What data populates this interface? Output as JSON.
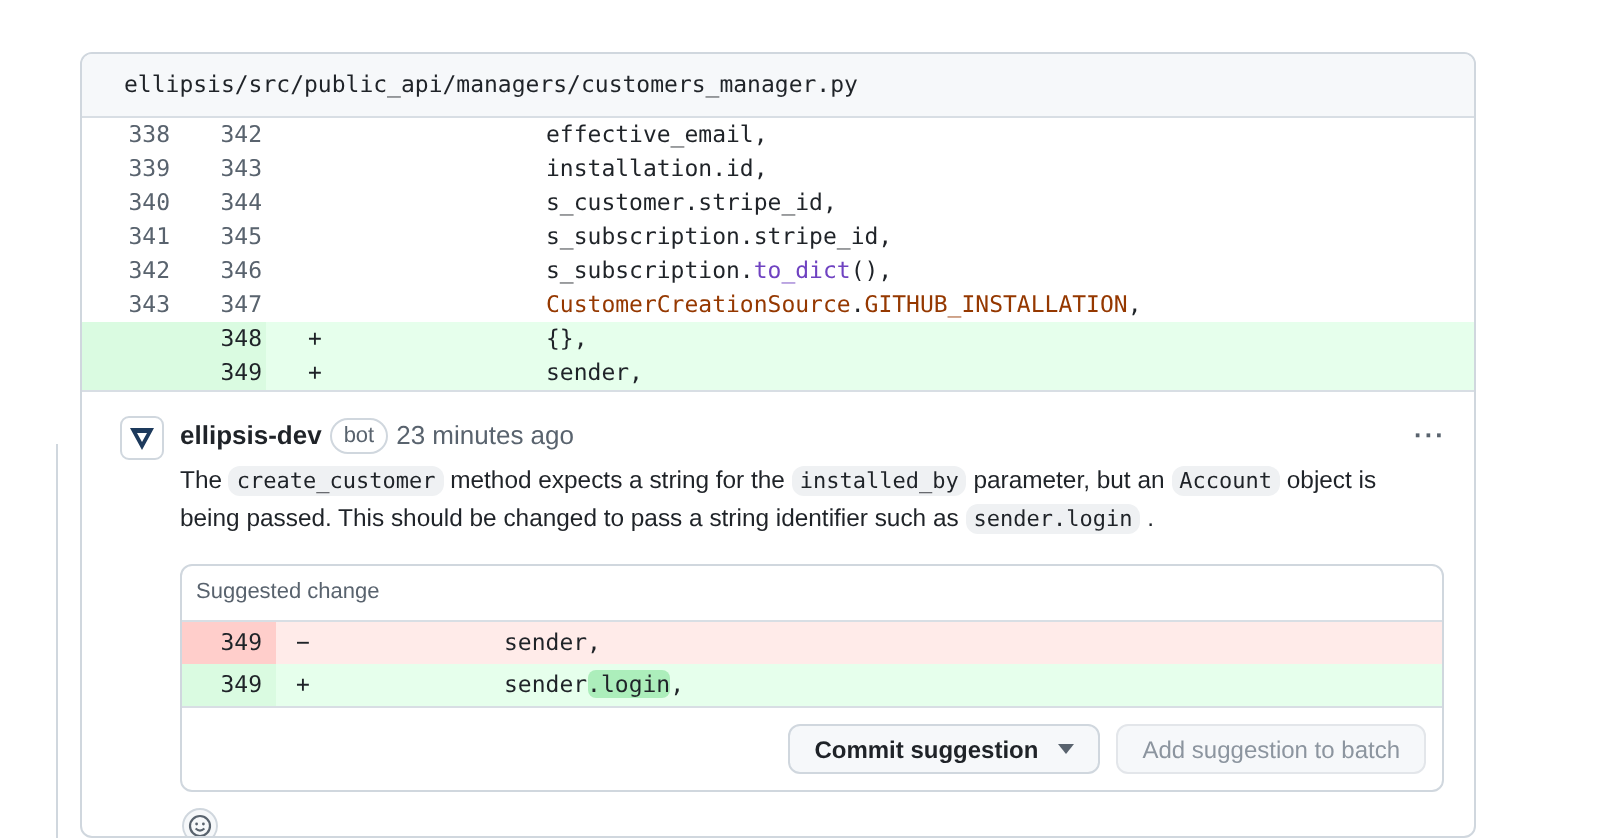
{
  "file": {
    "path": "ellipsis/src/public_api/managers/customers_manager.py",
    "lines": [
      {
        "kind": "context",
        "old": "338",
        "new": "342",
        "tokens": [
          {
            "kind": "plain",
            "text": "effective_email,"
          }
        ]
      },
      {
        "kind": "context",
        "old": "339",
        "new": "343",
        "tokens": [
          {
            "kind": "plain",
            "text": "installation.id,"
          }
        ]
      },
      {
        "kind": "context",
        "old": "340",
        "new": "344",
        "tokens": [
          {
            "kind": "plain",
            "text": "s_customer.stripe_id,"
          }
        ]
      },
      {
        "kind": "context",
        "old": "341",
        "new": "345",
        "tokens": [
          {
            "kind": "plain",
            "text": "s_subscription.stripe_id,"
          }
        ]
      },
      {
        "kind": "context",
        "old": "342",
        "new": "346",
        "tokens": [
          {
            "kind": "plain",
            "text": "s_subscription."
          },
          {
            "kind": "function",
            "text": "to_dict"
          },
          {
            "kind": "plain",
            "text": "(),"
          }
        ]
      },
      {
        "kind": "context",
        "old": "343",
        "new": "347",
        "tokens": [
          {
            "kind": "class",
            "text": "CustomerCreationSource"
          },
          {
            "kind": "plain",
            "text": "."
          },
          {
            "kind": "constant",
            "text": "GITHUB_INSTALLATION"
          },
          {
            "kind": "plain",
            "text": ","
          }
        ]
      },
      {
        "kind": "added",
        "new": "348",
        "marker": "+",
        "tokens": [
          {
            "kind": "plain",
            "text": "{},"
          }
        ]
      },
      {
        "kind": "added",
        "new": "349",
        "marker": "+",
        "tokens": [
          {
            "kind": "plain",
            "text": "sender,"
          }
        ]
      }
    ]
  },
  "comment": {
    "author": "ellipsis-dev",
    "badge": "bot",
    "time": "23 minutes ago",
    "menu": "···",
    "body": [
      {
        "kind": "text",
        "text": "The "
      },
      {
        "kind": "code",
        "text": "create_customer"
      },
      {
        "kind": "text",
        "text": " method expects a string for the "
      },
      {
        "kind": "code",
        "text": "installed_by"
      },
      {
        "kind": "text",
        "text": " parameter, but an "
      },
      {
        "kind": "code",
        "text": "Account"
      },
      {
        "kind": "text",
        "text": " object is being passed. This should be changed to pass a string identifier such as "
      },
      {
        "kind": "code",
        "text": "sender.login"
      },
      {
        "kind": "text",
        "text": " ."
      }
    ],
    "suggestion": {
      "title": "Suggested change",
      "lines": [
        {
          "kind": "removed",
          "num": "349",
          "marker": "−",
          "tokens": [
            {
              "kind": "plain",
              "text": "sender,"
            }
          ]
        },
        {
          "kind": "added",
          "num": "349",
          "marker": "+",
          "tokens": [
            {
              "kind": "plain",
              "text": "sender"
            },
            {
              "kind": "highlight",
              "text": ".login"
            },
            {
              "kind": "plain",
              "text": ","
            }
          ]
        }
      ],
      "buttons": [
        {
          "label": "Commit suggestion",
          "disabled": false,
          "dropdown": true
        },
        {
          "label": "Add suggestion to batch",
          "disabled": true,
          "dropdown": false
        }
      ]
    }
  }
}
